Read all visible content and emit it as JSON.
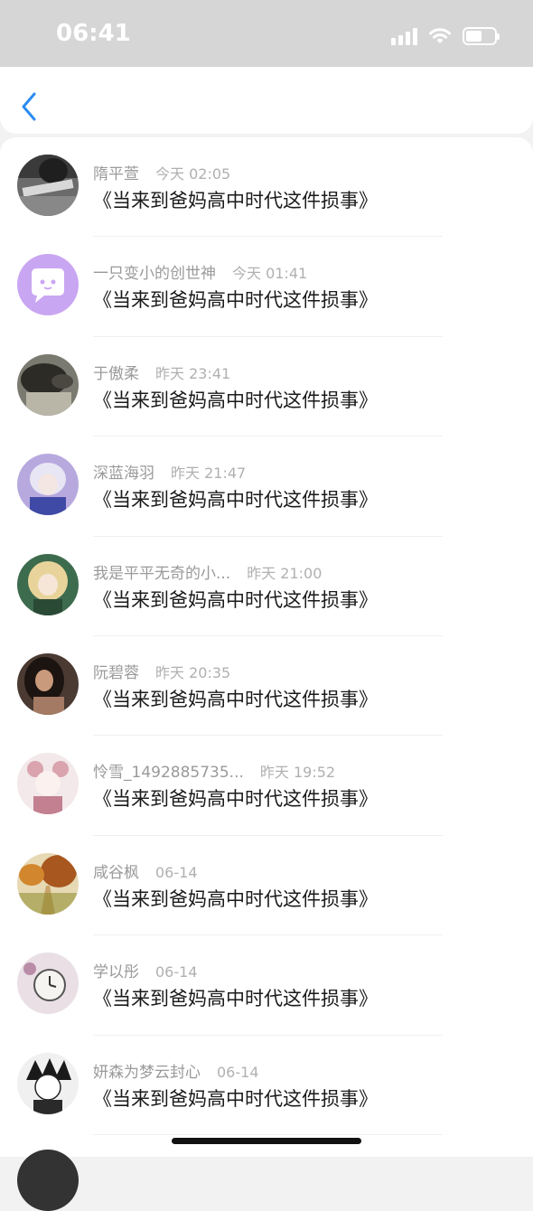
{
  "status_bar": {
    "time": "06:41"
  },
  "messages": [
    {
      "name": "隋平萱",
      "time": "今天 02:05",
      "text": "《当来到爸妈高中时代这件损事》",
      "avatar": "avatar-dark-handwriting"
    },
    {
      "name": "一只变小的创世神",
      "time": "今天 01:41",
      "text": "《当来到爸妈高中时代这件损事》",
      "avatar": "avatar-purple-chat"
    },
    {
      "name": "于傲柔",
      "time": "昨天 23:41",
      "text": "《当来到爸妈高中时代这件损事》",
      "avatar": "avatar-person-dark"
    },
    {
      "name": "深蓝海羽",
      "time": "昨天 21:47",
      "text": "《当来到爸妈高中时代这件损事》",
      "avatar": "avatar-anime-blue"
    },
    {
      "name": "我是平平无奇的小...",
      "time": "昨天 21:00",
      "text": "《当来到爸妈高中时代这件损事》",
      "avatar": "avatar-anime-green"
    },
    {
      "name": "阮碧蓉",
      "time": "昨天 20:35",
      "text": "《当来到爸妈高中时代这件损事》",
      "avatar": "avatar-girl-dark"
    },
    {
      "name": "怜雪_1492885735...",
      "time": "昨天 19:52",
      "text": "《当来到爸妈高中时代这件损事》",
      "avatar": "avatar-anime-pink"
    },
    {
      "name": "咸谷枫",
      "time": "06-14",
      "text": "《当来到爸妈高中时代这件损事》",
      "avatar": "avatar-autumn-road"
    },
    {
      "name": "学以彤",
      "time": "06-14",
      "text": "《当来到爸妈高中时代这件损事》",
      "avatar": "avatar-pocket-watch"
    },
    {
      "name": "妍森为梦云封心",
      "time": "06-14",
      "text": "《当来到爸妈高中时代这件损事》",
      "avatar": "avatar-anime-sketch"
    }
  ],
  "colors": {
    "accent": "#2a8cf0",
    "status_bar_bg": "#d6d6d6",
    "name_gray": "#9a9a9a",
    "message_text": "#1a1a1a"
  },
  "icons": [
    "back-chevron-icon",
    "signal-icon",
    "wifi-icon",
    "battery-icon"
  ]
}
